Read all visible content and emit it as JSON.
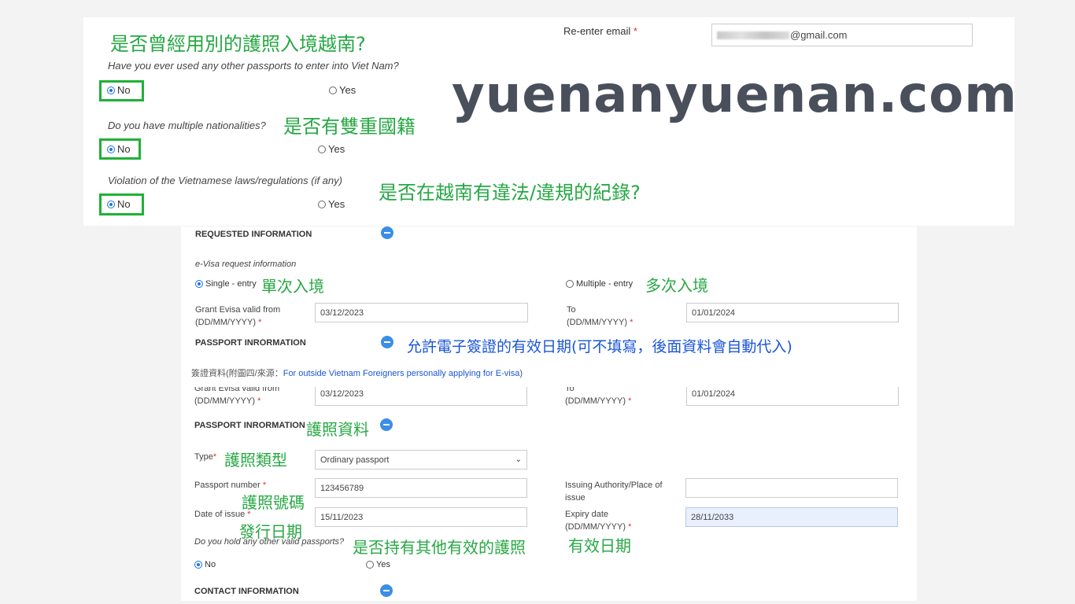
{
  "top": {
    "q1_zh": "是否曾經用別的護照入境越南?",
    "q1_en": "Have you ever used any other passports to enter into Viet Nam?",
    "q2_en": "Do you have multiple nationalities?",
    "q2_zh": "是否有雙重國籍",
    "q3_en": "Violation of the Vietnamese laws/regulations (if any)",
    "q3_zh": "是否在越南有違法/違規的紀錄?",
    "no": "No",
    "yes": "Yes",
    "reenter_label": "Re-enter email",
    "required_star": "*",
    "email_value": "@gmail.com",
    "watermark": "yuenanyuenan.com"
  },
  "requested": {
    "title": "REQUESTED INFORMATION",
    "subtitle": "e-Visa request information",
    "single": "Single - entry",
    "single_zh": "單次入境",
    "multiple": "Multiple - entry",
    "multiple_zh": "多次入境",
    "valid_from_label": "Grant Evisa valid from",
    "date_fmt": "(DD/MM/YYYY)",
    "valid_from": "03/12/2023",
    "to_label": "To",
    "to_value": "01/01/2024",
    "note_zh": "允許電子簽證的有效日期(可不填寫，後面資料會自動代入)"
  },
  "passport_header_partial": "PASSPORT INRORMATION",
  "caption": {
    "prefix": "簽證資料(附圖四/來源：",
    "link": "For outside Vietnam Foreigners personally applying for E-visa",
    "suffix": ")"
  },
  "second": {
    "valid_from_label": "Grant Evisa valid from",
    "valid_from": "03/12/2023",
    "to_label": "To",
    "to_value": "01/01/2024"
  },
  "passport": {
    "title": "PASSPORT INRORMATION",
    "title_zh": "護照資料",
    "type_label": "Type",
    "type_zh": "護照類型",
    "type_value": "Ordinary passport",
    "number_label": "Passport number",
    "number_zh": "護照號碼",
    "number_value": "123456789",
    "authority_label_1": "Issuing Authority/Place of",
    "authority_label_2": "issue",
    "issue_label": "Date of issue",
    "issue_zh": "發行日期",
    "issue_value": "15/11/2023",
    "expiry_label": "Expiry date",
    "expiry_value": "28/11/2033",
    "expiry_zh": "有效日期",
    "other_q": "Do you hold any other valid passports?",
    "other_zh": "是否持有其他有效的護照",
    "no": "No",
    "yes": "Yes"
  },
  "contact": {
    "title": "CONTACT INFORMATION"
  }
}
